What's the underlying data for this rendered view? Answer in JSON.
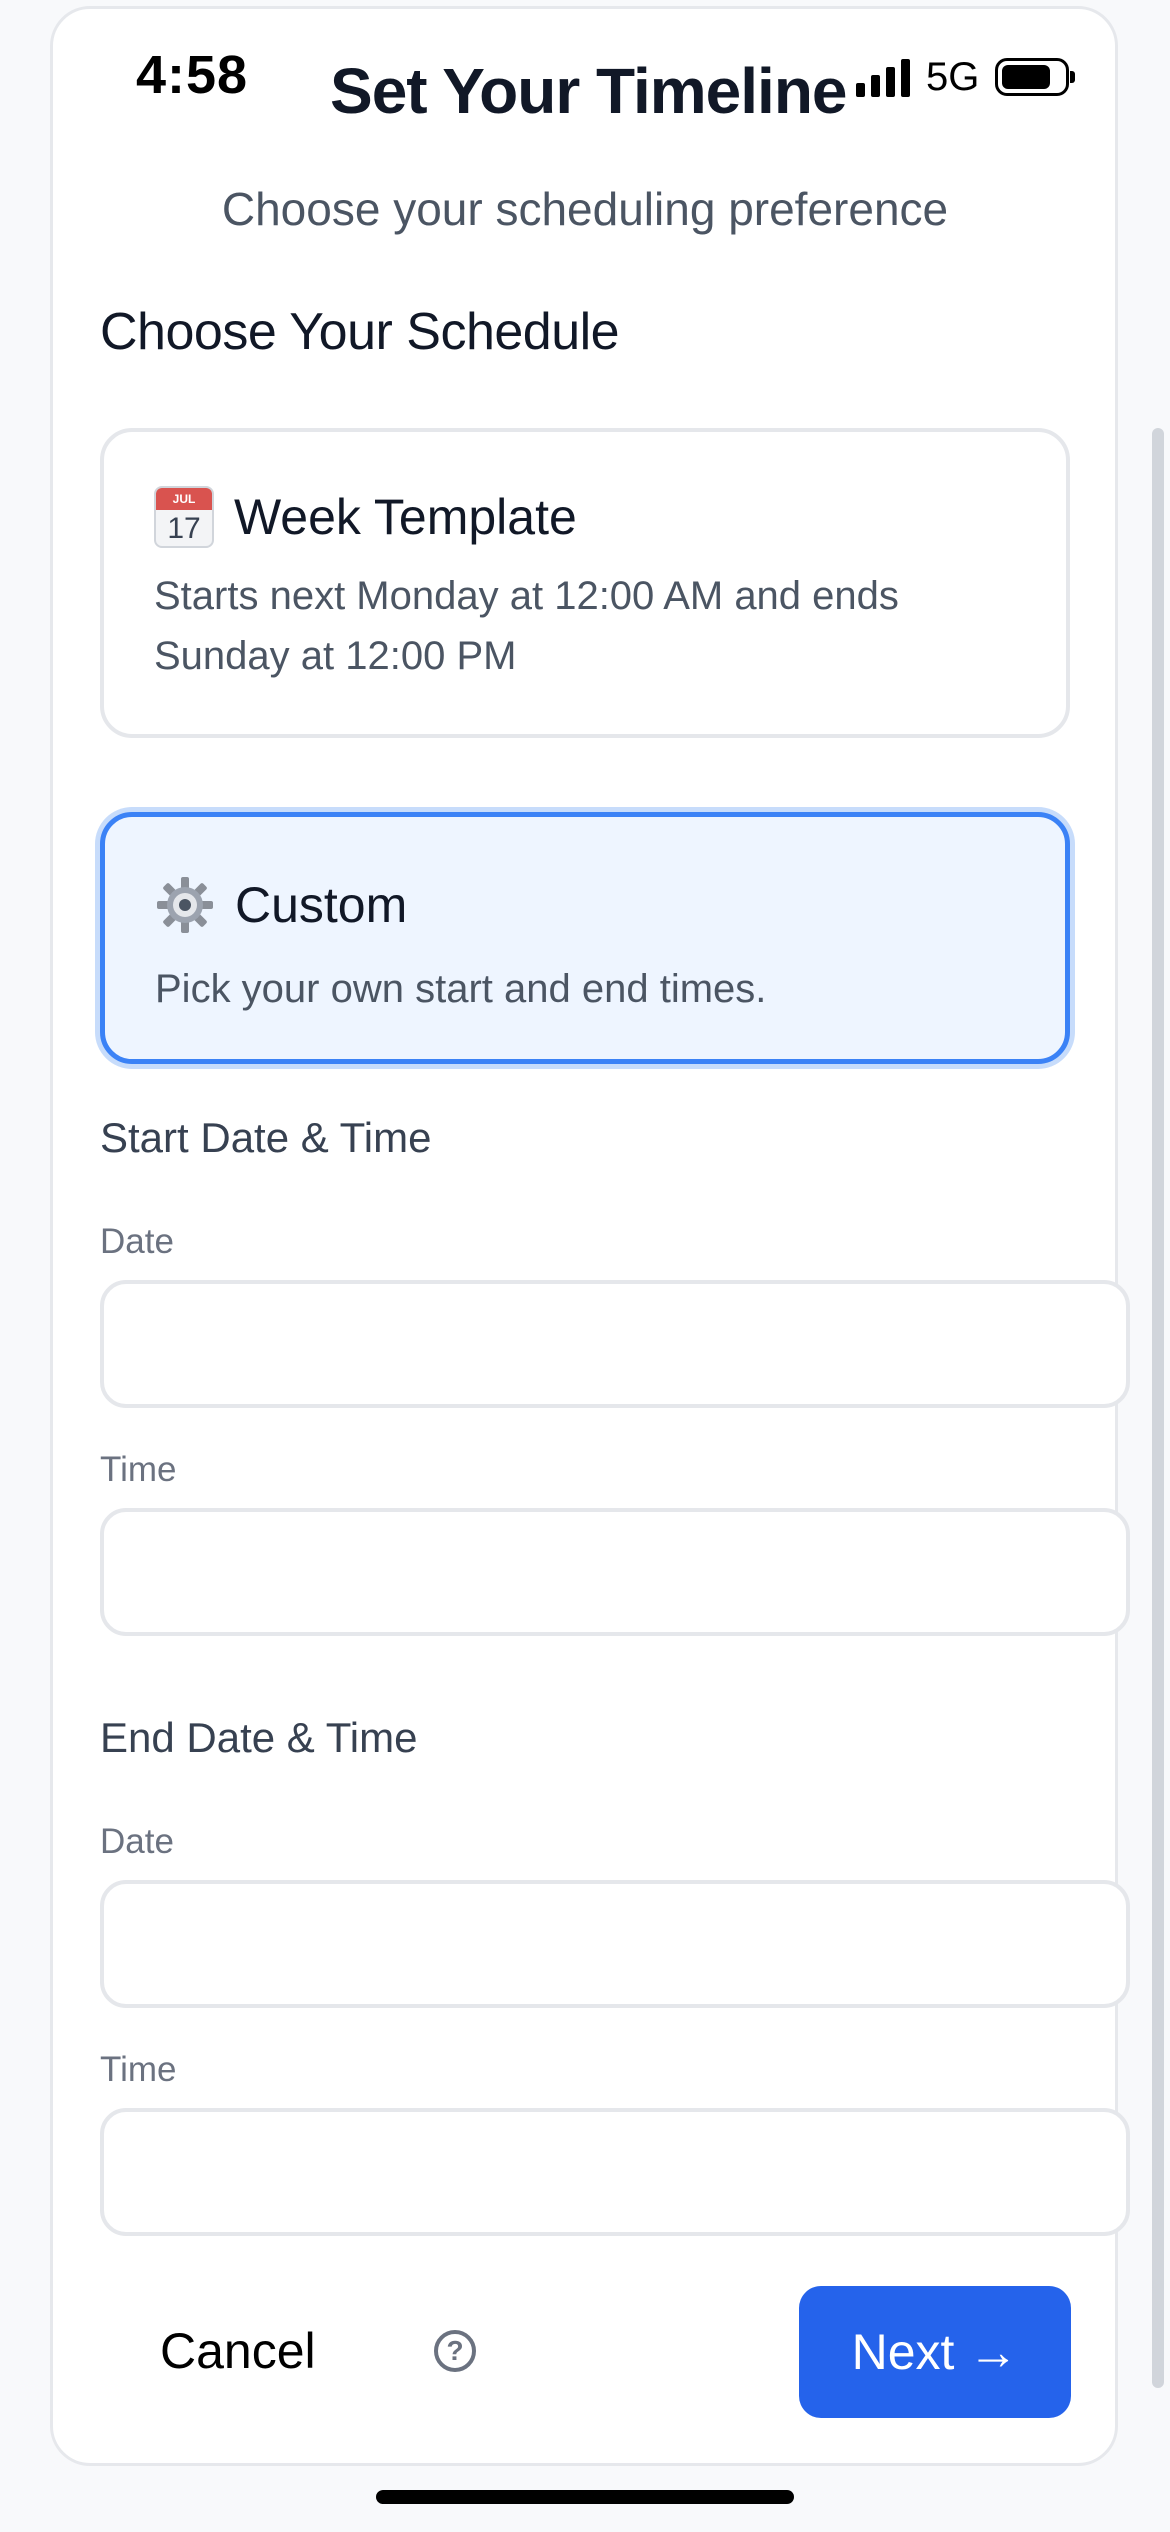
{
  "status_bar": {
    "time": "4:58",
    "network": "5G"
  },
  "header": {
    "title": "Set Your Timeline",
    "subtitle": "Choose your scheduling preference"
  },
  "schedule": {
    "heading": "Choose Your Schedule",
    "selected": "custom",
    "options": [
      {
        "id": "week",
        "icon": "calendar-icon",
        "icon_month": "JUL",
        "icon_day": "17",
        "title": "Week Template",
        "description": "Starts next Monday at 12:00 AM and ends Sunday at 12:00 PM"
      },
      {
        "id": "custom",
        "icon": "gear-icon",
        "title": "Custom",
        "description": "Pick your own start and end times."
      }
    ]
  },
  "start": {
    "heading": "Start Date & Time",
    "date_label": "Date",
    "date_value": "",
    "time_label": "Time",
    "time_value": ""
  },
  "end": {
    "heading": "End Date & Time",
    "date_label": "Date",
    "date_value": "",
    "time_label": "Time",
    "time_value": ""
  },
  "footer": {
    "cancel_label": "Cancel",
    "help_icon": "question-circle-icon",
    "next_label": "Next →"
  },
  "colors": {
    "accent": "#2563eb",
    "selected_border": "#3b82f6",
    "selected_bg": "#eef5ff"
  }
}
